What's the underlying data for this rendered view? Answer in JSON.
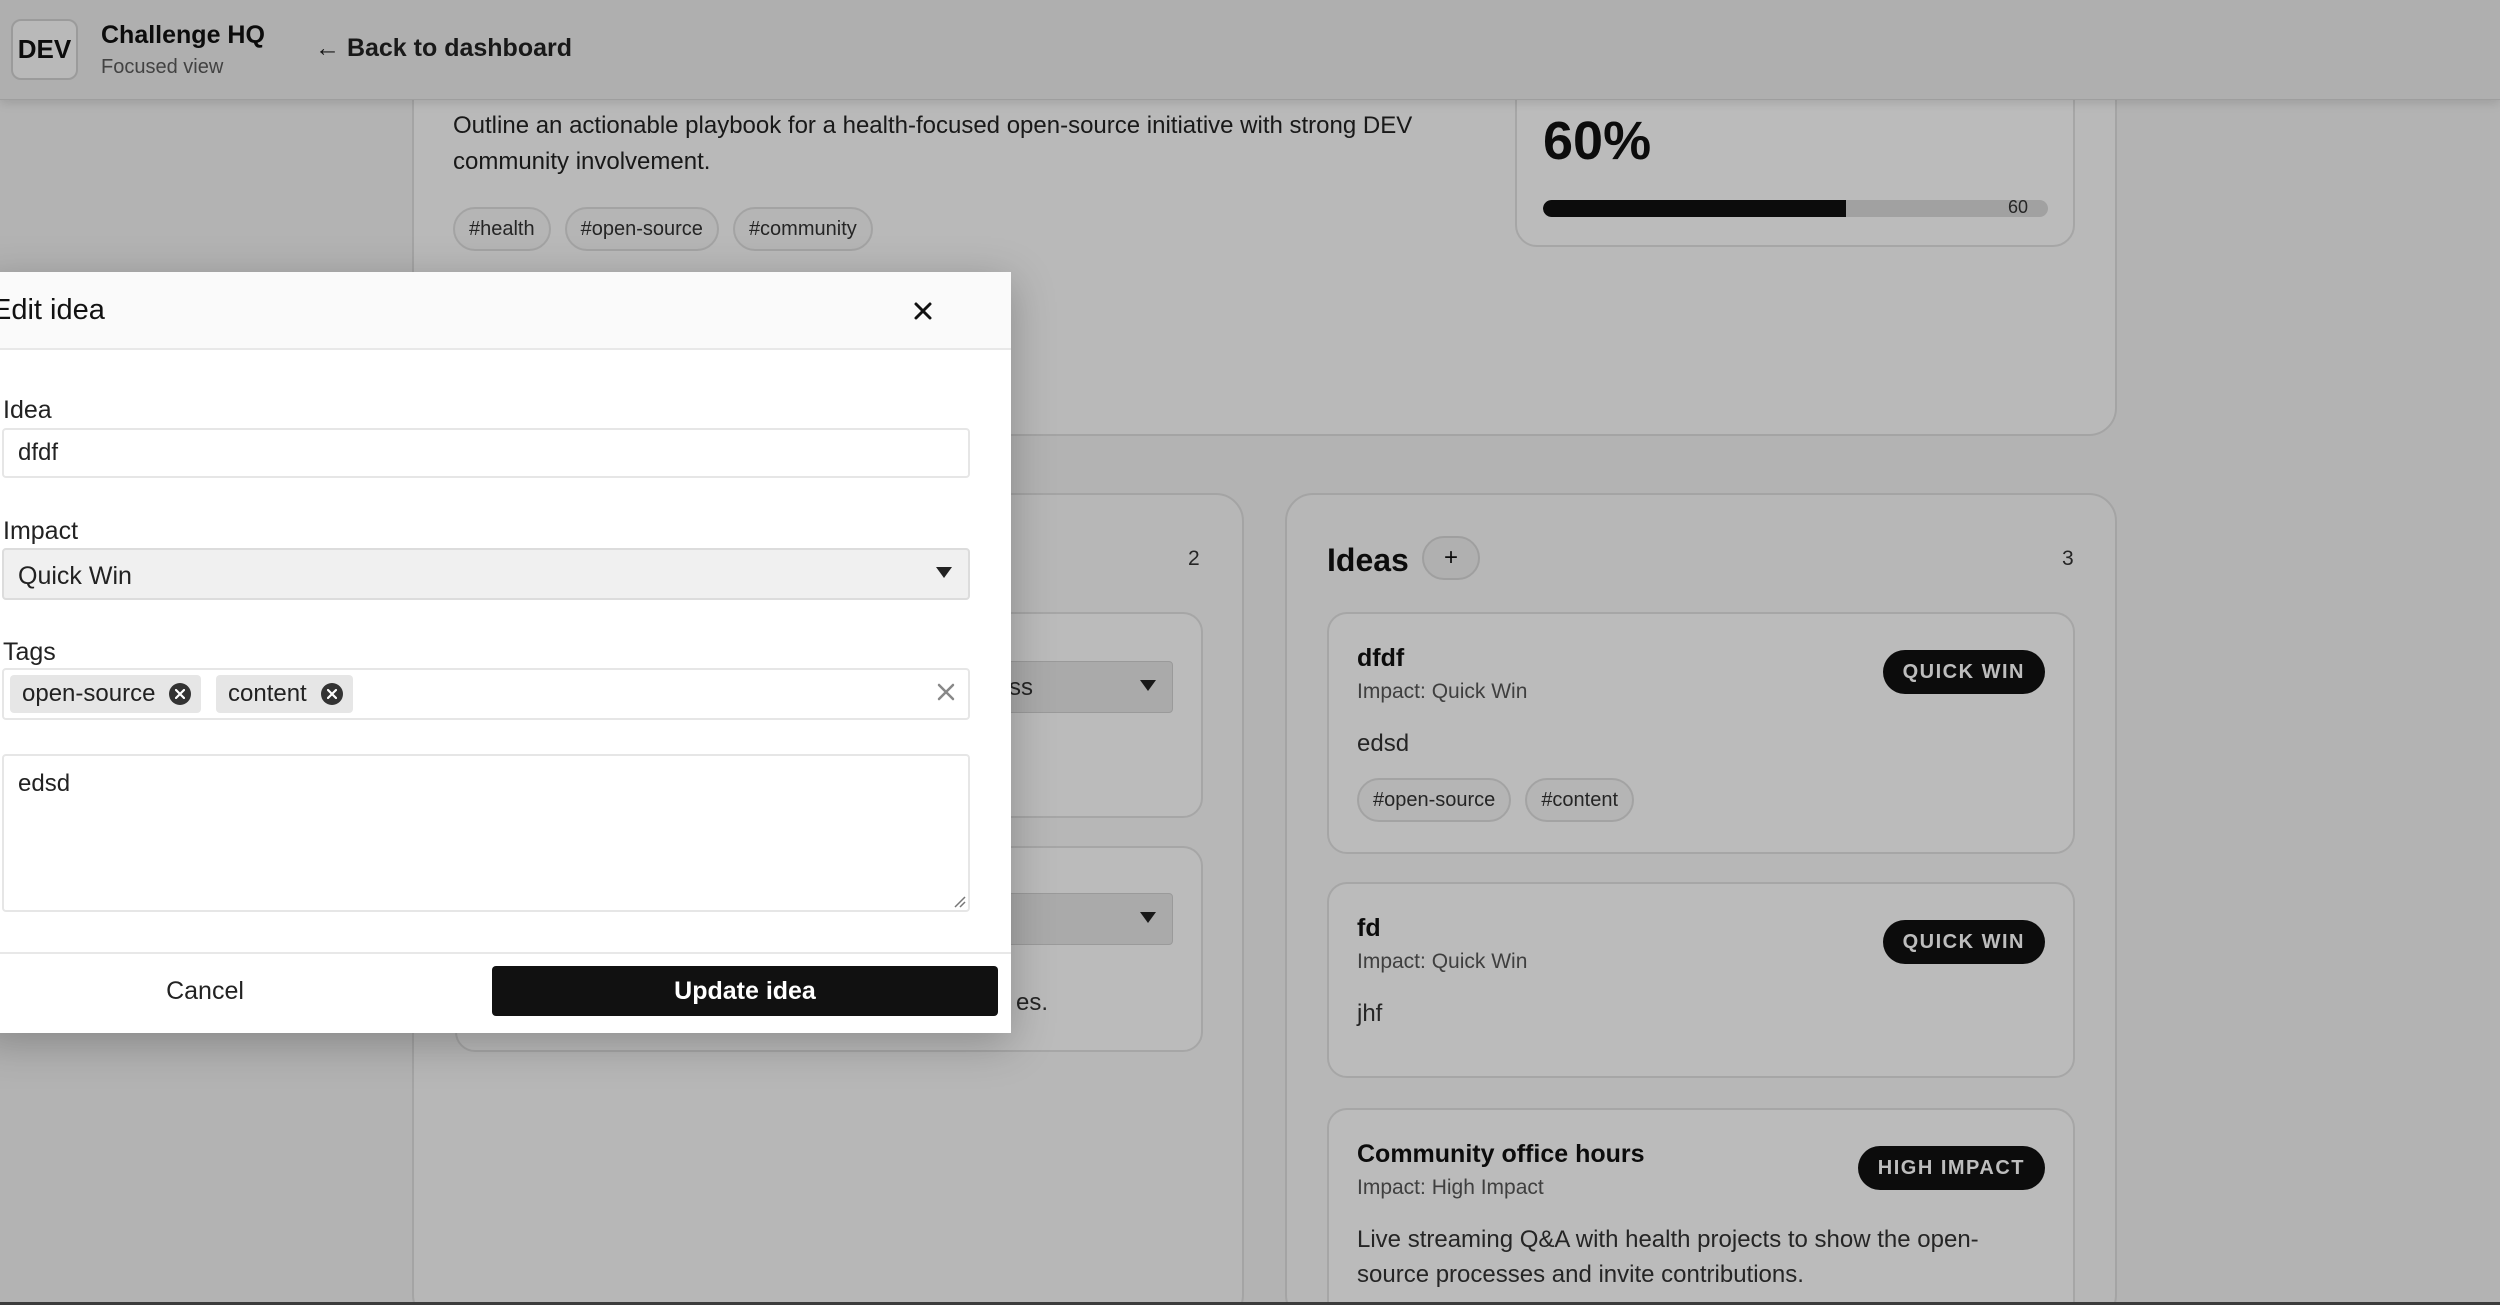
{
  "header": {
    "logo": "DEV",
    "title": "Challenge HQ",
    "subtitle": "Focused view",
    "back_link": "← Back to dashboard"
  },
  "challenge": {
    "description": "Outline an actionable playbook for a health-focused open-source initiative with strong DEV community involvement.",
    "tags": [
      "#health",
      "#open-source",
      "#community"
    ],
    "progress_label": "60%",
    "progress_value": 60
  },
  "left_column": {
    "count": "2",
    "select_fragment": "ss",
    "trailing_text": "es."
  },
  "ideas": {
    "title": "Ideas",
    "add_label": "+",
    "count": "3",
    "items": [
      {
        "title": "dfdf",
        "impact": "Impact: Quick Win",
        "badge": "QUICK WIN",
        "body": "edsd",
        "tags": [
          "#open-source",
          "#content"
        ]
      },
      {
        "title": "fd",
        "impact": "Impact: Quick Win",
        "badge": "QUICK WIN",
        "body": "jhf",
        "tags": []
      },
      {
        "title": "Community office hours",
        "impact": "Impact: High Impact",
        "badge": "HIGH IMPACT",
        "body": "Live streaming Q&A with health projects to show the open-source processes and invite contributions.",
        "tags": []
      }
    ]
  },
  "modal": {
    "title": "Edit idea",
    "idea_label": "Idea",
    "idea_value": "dfdf",
    "impact_label": "Impact",
    "impact_value": "Quick Win",
    "tags_label": "Tags",
    "tags": [
      "open-source",
      "content"
    ],
    "description_value": "edsd",
    "cancel_label": "Cancel",
    "submit_label": "Update idea"
  },
  "icons": {
    "close": "close-icon",
    "dropdown": "chevron-down-icon",
    "tag_remove": "remove-tag-icon",
    "clear": "clear-icon"
  },
  "colors": {
    "primary": "#111111",
    "badge_text": "#ffffff",
    "progress_track": "#d9d9d9"
  }
}
